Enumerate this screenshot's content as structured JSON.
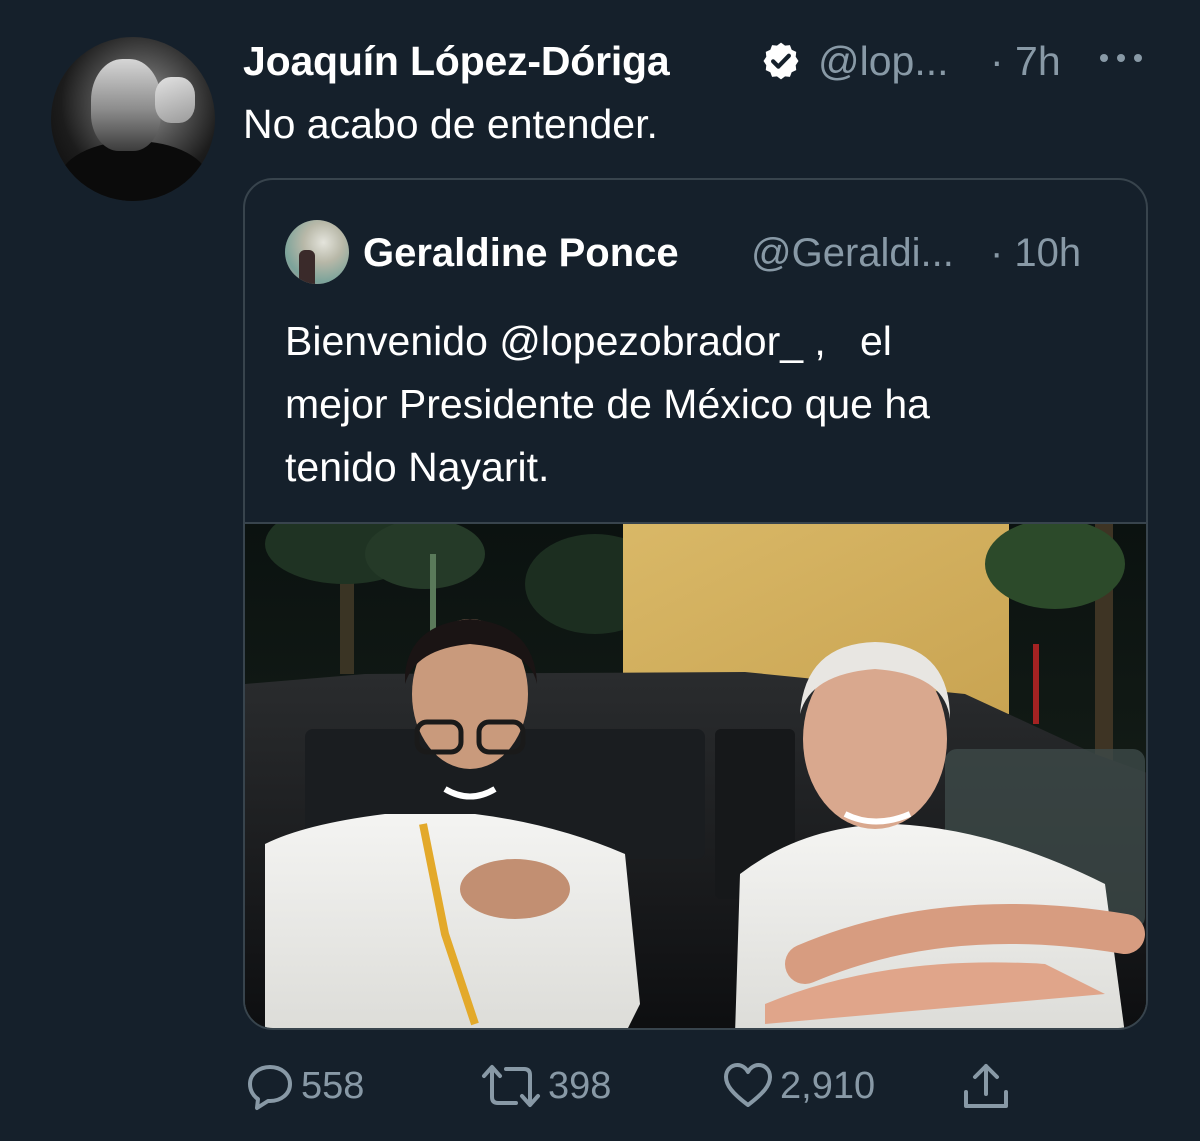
{
  "tweet": {
    "author_name": "Joaquín López-Dóriga",
    "author_handle": "@lop...",
    "time": "· 7h",
    "text": "No acabo de entender."
  },
  "quoted_tweet": {
    "author_name": "Geraldine Ponce",
    "author_handle": "@Geraldi...",
    "time": "· 10h",
    "text_lines": [
      "Bienvenido @lopezobrador_ ,   el",
      "mejor Presidente de México que ha",
      "tenido Nayarit."
    ]
  },
  "actions": {
    "replies": "558",
    "retweets": "398",
    "likes": "2,910"
  },
  "icons": {
    "verified": "verified-badge-icon",
    "more": "more-dots-icon",
    "reply": "reply-icon",
    "retweet": "retweet-icon",
    "like": "heart-icon",
    "share": "share-icon"
  },
  "colors": {
    "background": "#15202b",
    "secondary_text": "#8899a6",
    "border": "#38444d"
  }
}
